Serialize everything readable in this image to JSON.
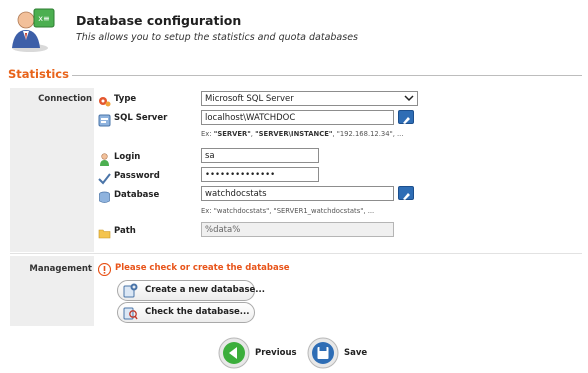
{
  "header": {
    "title": "Database configuration",
    "subtitle": "This allows you to setup the statistics and quota databases"
  },
  "statistics": {
    "section_title": "Statistics",
    "connection_label": "Connection",
    "type": {
      "label": "Type",
      "value": "Microsoft SQL Server"
    },
    "sql_server": {
      "label": "SQL Server",
      "value": "localhost\\WATCHDOC",
      "hint_prefix": "Ex: ",
      "hint_ex1": "\"SERVER\"",
      "hint_sep1": ", ",
      "hint_ex2": "\"SERVER\\INSTANCE\"",
      "hint_rest": ", \"192.168.12.34\", ..."
    },
    "login": {
      "label": "Login",
      "value": "sa"
    },
    "password": {
      "label": "Password",
      "value": "••••••••••••••"
    },
    "database": {
      "label": "Database",
      "value": "watchdocstats",
      "hint": "Ex: \"watchdocstats\", \"SERVER1_watchdocstats\", ..."
    },
    "path": {
      "label": "Path",
      "value": "%data%"
    }
  },
  "management": {
    "label": "Management",
    "warning": "Please check or create the database",
    "create_button": "Create a new database...",
    "check_button": "Check the database..."
  },
  "nav": {
    "previous": "Previous",
    "save": "Save"
  },
  "colors": {
    "accent_orange": "#e8631a",
    "warning": "#e8541a",
    "nav_green": "#3cae3c",
    "nav_blue": "#2e6db5"
  }
}
